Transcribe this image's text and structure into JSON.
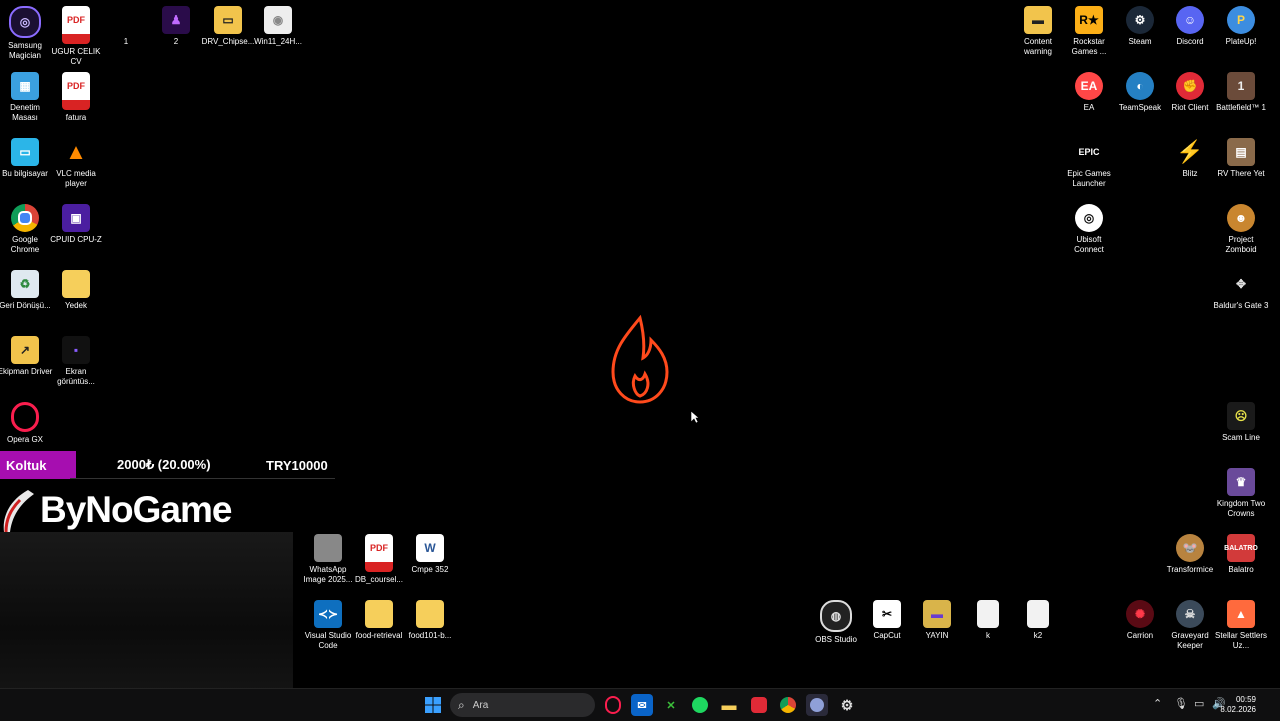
{
  "desktop_icons": {
    "samsung_magician": "Samsung Magician",
    "ugur_celik_cv": "UGUR CELIK CV",
    "folder_1": "1",
    "folder_2": "2",
    "drv_chipset": "DRV_Chipse...",
    "win11": "Win11_24H...",
    "denetim_masasi": "Denetim Masası",
    "fatura": "fatura",
    "bu_bilgisayar": "Bu bilgisayar",
    "vlc": "VLC media player",
    "google_chrome": "Google Chrome",
    "cpuid": "CPUID CPU-Z",
    "geri_donusum": "Geri Dönüşü...",
    "yedek": "Yedek",
    "ekipman_driver": "Ekipman Driver",
    "ekran_goruntusu": "Ekran görüntüs...",
    "opera_gx": "Opera GX",
    "whatsapp_image": "WhatsApp Image 2025...",
    "db_course": "DB_coursel...",
    "cmpe_352": "Cmpe 352",
    "vscode": "Visual Studio Code",
    "food_retrieval": "food-retrieval",
    "food101": "food101-b...",
    "obs_studio": "OBS Studio",
    "capcut": "CapCut",
    "yayin": "YAYIN",
    "k": "k",
    "k2": "k2",
    "content_warning": "Content warning",
    "rockstar": "Rockstar Games ...",
    "steam": "Steam",
    "discord": "Discord",
    "plateup": "PlateUp!",
    "ea": "EA",
    "teamspeak": "TeamSpeak",
    "riot_client": "Riot Client",
    "battlefield": "Battlefield™ 1",
    "epic": "Epic Games Launcher",
    "blitz": "Blitz",
    "rv_there_yet": "RV There Yet",
    "ubisoft": "Ubisoft Connect",
    "project_zomboid": "Project Zomboid",
    "baldurs_gate": "Baldur's Gate 3",
    "scam_line": "Scam Line",
    "kingdom": "Kingdom Two Crowns",
    "transformice": "Transformice",
    "balatro": "Balatro",
    "carrion": "Carrion",
    "graveyard_keeper": "Graveyard Keeper",
    "stellar_settlers": "Stellar Settlers Uz..."
  },
  "overlay": {
    "tag": "Koltuk",
    "amount": "2000₺ (20.00%)",
    "goal": "TRY10000",
    "brand": "ByNoGame"
  },
  "taskbar": {
    "search_placeholder": "Ara",
    "time": "00:59",
    "date": "8.02.2026"
  },
  "colors": {
    "overlay_tag": "#a60eb0",
    "flame": "#ff4a1c"
  }
}
